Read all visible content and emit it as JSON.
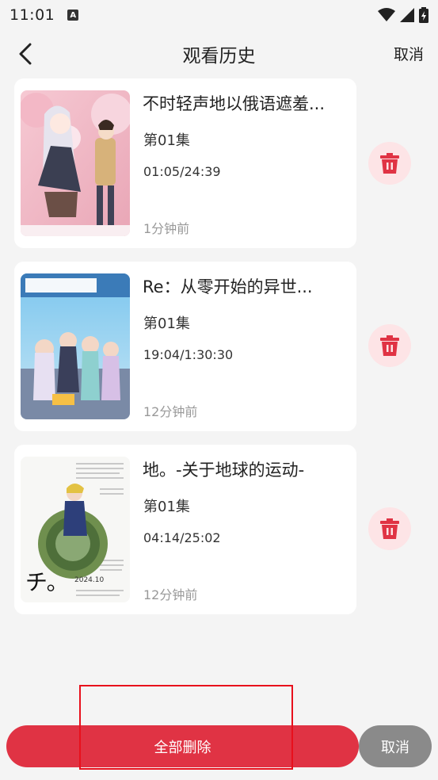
{
  "status": {
    "time": "11:01",
    "notify_letter": "A"
  },
  "header": {
    "title": "观看历史",
    "cancel_label": "取消"
  },
  "items": [
    {
      "title": "不时轻声地以俄语遮羞...",
      "episode": "第01集",
      "progress": "01:05/24:39",
      "watched_ago": "1分钟前"
    },
    {
      "title": "Re：从零开始的异世...",
      "episode": "第01集",
      "progress": "19:04/1:30:30",
      "watched_ago": "12分钟前"
    },
    {
      "title": "地。-关于地球的运动-",
      "episode": "第01集",
      "progress": "04:14/25:02",
      "watched_ago": "12分钟前"
    }
  ],
  "bottom": {
    "delete_all_label": "全部删除",
    "cancel_label": "取消"
  },
  "colors": {
    "accent": "#e03344",
    "delete_bg": "#fde4e6",
    "cancel_bg": "#8a8a8a"
  }
}
